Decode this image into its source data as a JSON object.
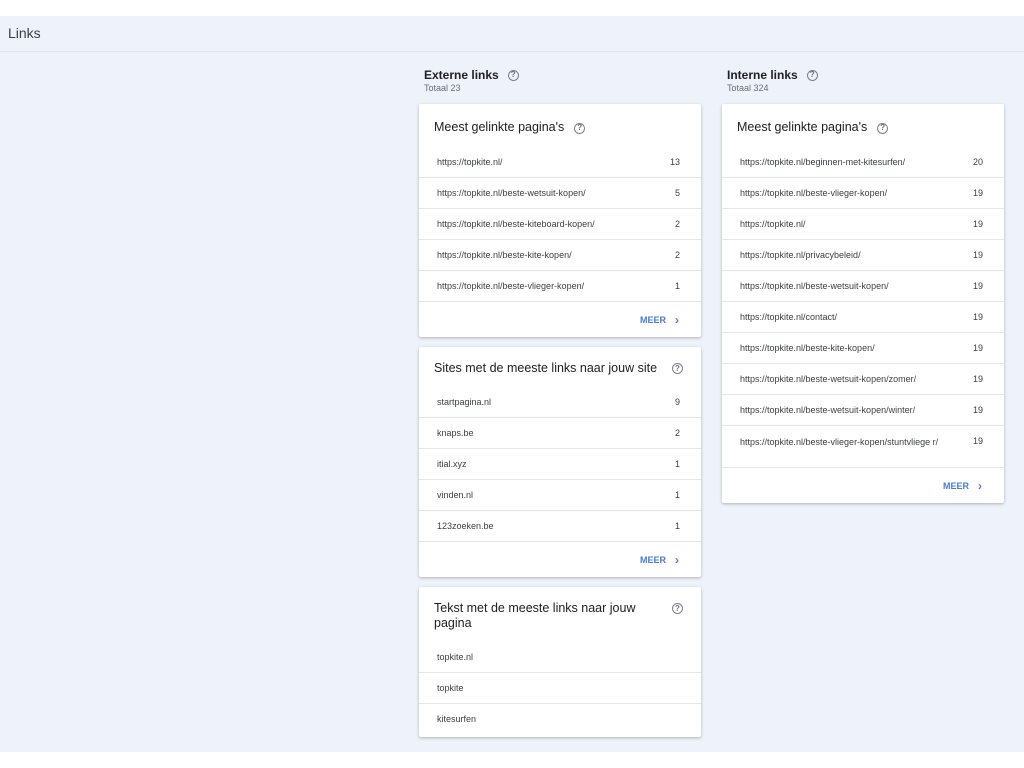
{
  "page": {
    "title": "Links"
  },
  "external": {
    "title": "Externe links",
    "subtitle": "Totaal 23",
    "top_pages": {
      "title": "Meest gelinkte pagina's",
      "rows": [
        {
          "url": "https://topkite.nl/",
          "count": "13"
        },
        {
          "url": "https://topkite.nl/beste-wetsuit-kopen/",
          "count": "5"
        },
        {
          "url": "https://topkite.nl/beste-kiteboard-kopen/",
          "count": "2"
        },
        {
          "url": "https://topkite.nl/beste-kite-kopen/",
          "count": "2"
        },
        {
          "url": "https://topkite.nl/beste-vlieger-kopen/",
          "count": "1"
        }
      ],
      "more": "MEER"
    },
    "top_sites": {
      "title": "Sites met de meeste links naar jouw site",
      "rows": [
        {
          "url": "startpagina.nl",
          "count": "9"
        },
        {
          "url": "knaps.be",
          "count": "2"
        },
        {
          "url": "itial.xyz",
          "count": "1"
        },
        {
          "url": "vinden.nl",
          "count": "1"
        },
        {
          "url": "123zoeken.be",
          "count": "1"
        }
      ],
      "more": "MEER"
    },
    "top_text": {
      "title": "Tekst met de meeste links naar jouw pagina",
      "rows": [
        {
          "text": "topkite.nl"
        },
        {
          "text": "topkite"
        },
        {
          "text": "kitesurfen"
        }
      ]
    }
  },
  "internal": {
    "title": "Interne links",
    "subtitle": "Totaal 324",
    "top_pages": {
      "title": "Meest gelinkte pagina's",
      "rows": [
        {
          "url": "https://topkite.nl/beginnen-met-kitesurfen/",
          "count": "20"
        },
        {
          "url": "https://topkite.nl/beste-vlieger-kopen/",
          "count": "19"
        },
        {
          "url": "https://topkite.nl/",
          "count": "19"
        },
        {
          "url": "https://topkite.nl/privacybeleid/",
          "count": "19"
        },
        {
          "url": "https://topkite.nl/beste-wetsuit-kopen/",
          "count": "19"
        },
        {
          "url": "https://topkite.nl/contact/",
          "count": "19"
        },
        {
          "url": "https://topkite.nl/beste-kite-kopen/",
          "count": "19"
        },
        {
          "url": "https://topkite.nl/beste-wetsuit-kopen/zomer/",
          "count": "19"
        },
        {
          "url": "https://topkite.nl/beste-wetsuit-kopen/winter/",
          "count": "19"
        },
        {
          "url": "https://topkite.nl/beste-vlieger-kopen/stuntvliege r/",
          "count": "19"
        }
      ],
      "more": "MEER"
    }
  },
  "icons": {
    "help": "help-circle-icon",
    "chevron": "chevron-right-icon"
  },
  "colors": {
    "accent": "#4a7ad9",
    "background": "#eef2fa"
  }
}
